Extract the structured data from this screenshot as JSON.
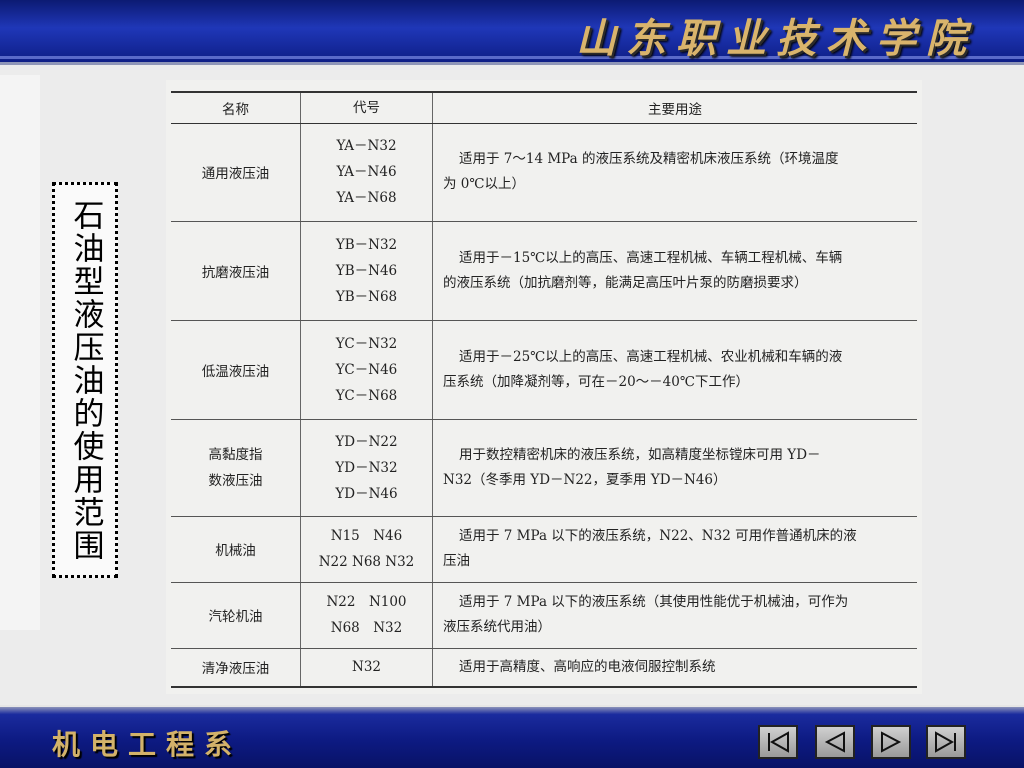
{
  "header": {
    "college_name": "山东职业技术学院"
  },
  "side_title": "石油型液压油的使用范围",
  "table": {
    "columns": [
      "名称",
      "代号",
      "主要用途"
    ],
    "rows": [
      {
        "name": [
          "通用液压油"
        ],
        "codes": [
          "YA－N32",
          "YA－N46",
          "YA－N68"
        ],
        "usage": [
          "适用于 7～14 MPa 的液压系统及精密机床液压系统（环境温度",
          "为 0℃以上）"
        ]
      },
      {
        "name": [
          "抗磨液压油"
        ],
        "codes": [
          "YB－N32",
          "YB－N46",
          "YB－N68"
        ],
        "usage": [
          "适用于－15℃以上的高压、高速工程机械、车辆工程机械、车辆",
          "的液压系统（加抗磨剂等，能满足高压叶片泵的防磨损要求）"
        ]
      },
      {
        "name": [
          "低温液压油"
        ],
        "codes": [
          "YC－N32",
          "YC－N46",
          "YC－N68"
        ],
        "usage": [
          "适用于－25℃以上的高压、高速工程机械、农业机械和车辆的液",
          "压系统（加降凝剂等，可在－20～－40℃下工作）"
        ]
      },
      {
        "name": [
          "高黏度指",
          "数液压油"
        ],
        "codes": [
          "YD－N22",
          "YD－N32",
          "YD－N46"
        ],
        "usage": [
          "用于数控精密机床的液压系统，如高精度坐标镗床可用 YD－",
          "N32（冬季用 YD－N22，夏季用 YD－N46）"
        ]
      },
      {
        "name": [
          "机械油"
        ],
        "codes": [
          "N15　N46",
          "N22 N68 N32"
        ],
        "usage": [
          "适用于 7 MPa 以下的液压系统，N22、N32 可用作普通机床的液",
          "压油"
        ]
      },
      {
        "name": [
          "汽轮机油"
        ],
        "codes": [
          "N22　N100",
          "N68　N32"
        ],
        "usage": [
          "适用于 7 MPa 以下的液压系统（其使用性能优于机械油，可作为",
          "液压系统代用油）"
        ]
      },
      {
        "name": [
          "清净液压油"
        ],
        "codes": [
          "N32"
        ],
        "usage": [
          "适用于高精度、高响应的电液伺服控制系统"
        ]
      }
    ]
  },
  "footer": {
    "department": "机电工程系",
    "nav": [
      {
        "icon": "first-slide-icon"
      },
      {
        "icon": "previous-slide-icon"
      },
      {
        "icon": "next-slide-icon"
      },
      {
        "icon": "last-slide-icon"
      }
    ]
  },
  "colors": {
    "banner": "#0e1e86",
    "gold": "#d9b46c",
    "background": "#ececec"
  }
}
